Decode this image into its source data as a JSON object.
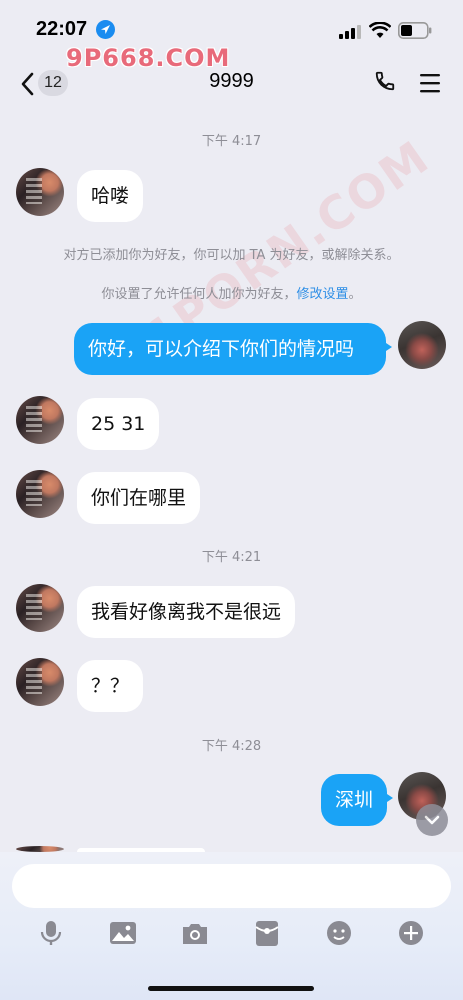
{
  "status_bar": {
    "time": "22:07",
    "watermark": "9P668.COM"
  },
  "nav": {
    "back_count": "12",
    "title": "9999"
  },
  "messages": {
    "t1": "下午 4:17",
    "m1": "哈喽",
    "sys1": "对方已添加你为好友，你可以加 TA 为好友，或解除关系。",
    "sys2_prefix": "你设置了允许任何人加你为好友，",
    "sys2_link": "修改设置",
    "sys2_suffix": "。",
    "m2": "你好，可以介绍下你们的情况吗",
    "m3": "25  31",
    "m4": "你们在哪里",
    "t2": "下午 4:21",
    "m5": "我看好像离我不是很远",
    "m6": "？？",
    "t3": "下午 4:28",
    "m7": "深圳"
  },
  "diagonal_watermark": "91PORN.COM",
  "composer": {
    "placeholder": ""
  },
  "toolbar": [
    "microphone-icon",
    "image-icon",
    "camera-icon",
    "red-packet-icon",
    "emoji-icon",
    "plus-icon"
  ],
  "colors": {
    "outgoing_bubble": "#1aa3f6",
    "background": "#ececf3",
    "link": "#2f8fe6"
  }
}
